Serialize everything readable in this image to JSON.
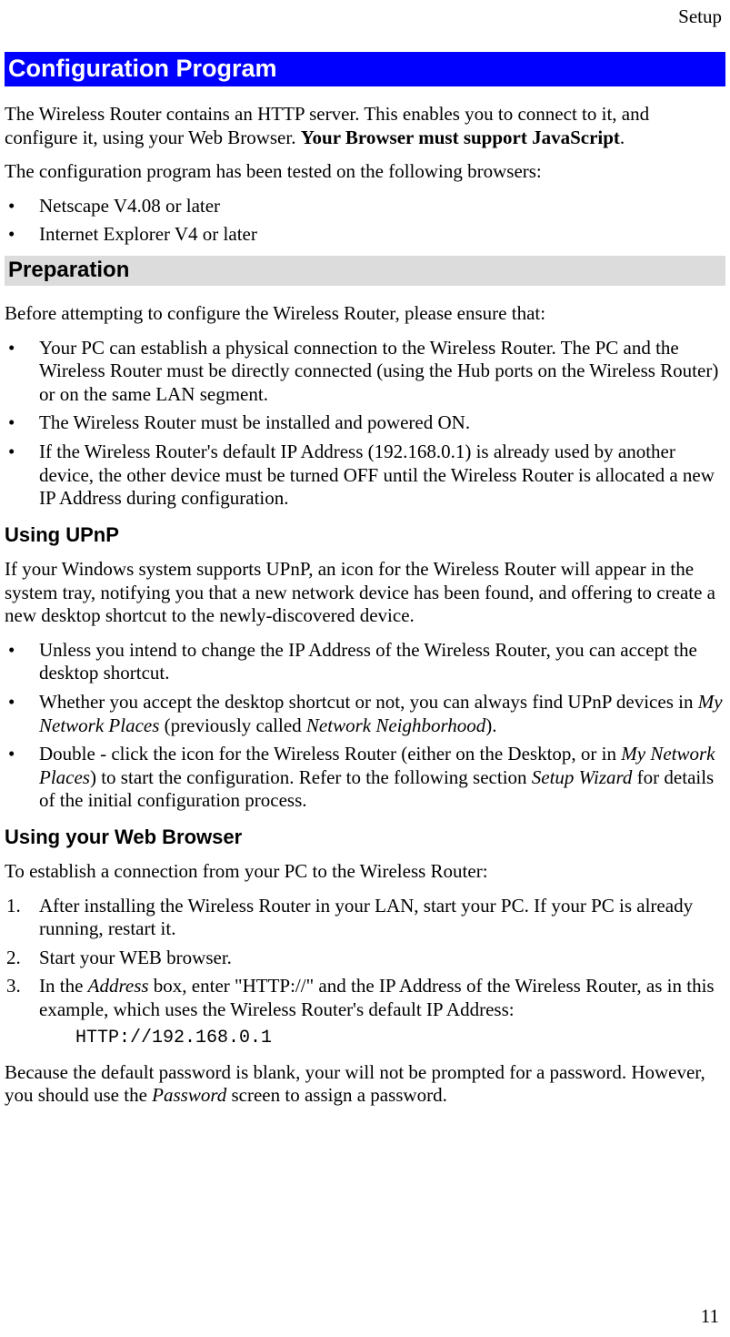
{
  "headerRight": "Setup",
  "h1": "Configuration Program",
  "intro1_a": "The Wireless Router contains an HTTP server. This enables you to connect to it, and configure it, using your Web Browser. ",
  "intro1_bold": "Your Browser must support JavaScript",
  "intro1_b": ".",
  "intro2": "The configuration program has been tested on the following browsers:",
  "browsersList": [
    "Netscape V4.08 or later",
    "Internet Explorer V4 or later"
  ],
  "h2_prep": "Preparation",
  "prep_intro": "Before attempting to configure the Wireless Router, please ensure that:",
  "prepList": [
    "Your PC can establish a physical connection to the Wireless Router. The PC and the Wireless Router must be directly connected (using the Hub ports on the Wireless Router) or on the same LAN segment.",
    "The Wireless Router must be installed and powered ON.",
    "If the Wireless Router's default IP Address (192.168.0.1) is already used by another device, the other device must be turned OFF until the Wireless Router is allocated a new IP Address during configuration."
  ],
  "h3_upnp": "Using UPnP",
  "upnp_intro": "If your Windows system supports UPnP, an icon for the Wireless Router will appear in the system tray, notifying you that a new network device has been found, and offering to create a new desktop shortcut to the newly-discovered device.",
  "upnp_list": {
    "item1": "Unless you intend to change the IP Address of the Wireless Router, you can accept the desktop shortcut.",
    "item2_a": "Whether you accept the desktop shortcut or not, you can always find UPnP devices in ",
    "item2_i1": "My Network Places",
    "item2_b": " (previously called ",
    "item2_i2": "Network Neighborhood",
    "item2_c": ").",
    "item3_a": "Double - click the icon for the Wireless Router (either on the Desktop, or in ",
    "item3_i1": "My Network Places",
    "item3_b": ") to start the configuration. Refer to the following section ",
    "item3_i2": "Setup Wizard",
    "item3_c": " for details of the initial configuration process."
  },
  "h3_web": "Using your Web Browser",
  "web_intro": "To establish a connection from your PC to the Wireless Router:",
  "web_steps": {
    "s1": "After installing the Wireless Router in your LAN, start your PC. If your PC is already running, restart it.",
    "s2": "Start your WEB browser.",
    "s3_a": "In the ",
    "s3_i1": "Address",
    "s3_b": " box, enter \"HTTP://\" and the IP Address of the Wireless Router, as in this example, which uses the Wireless Router's default IP Address:"
  },
  "http_example": "HTTP://192.168.0.1",
  "password_note_a": "Because the default password is blank, your will not be prompted for a password. However, you should use the ",
  "password_note_i": "Password",
  "password_note_b": " screen to assign a password.",
  "pageNumber": "11"
}
